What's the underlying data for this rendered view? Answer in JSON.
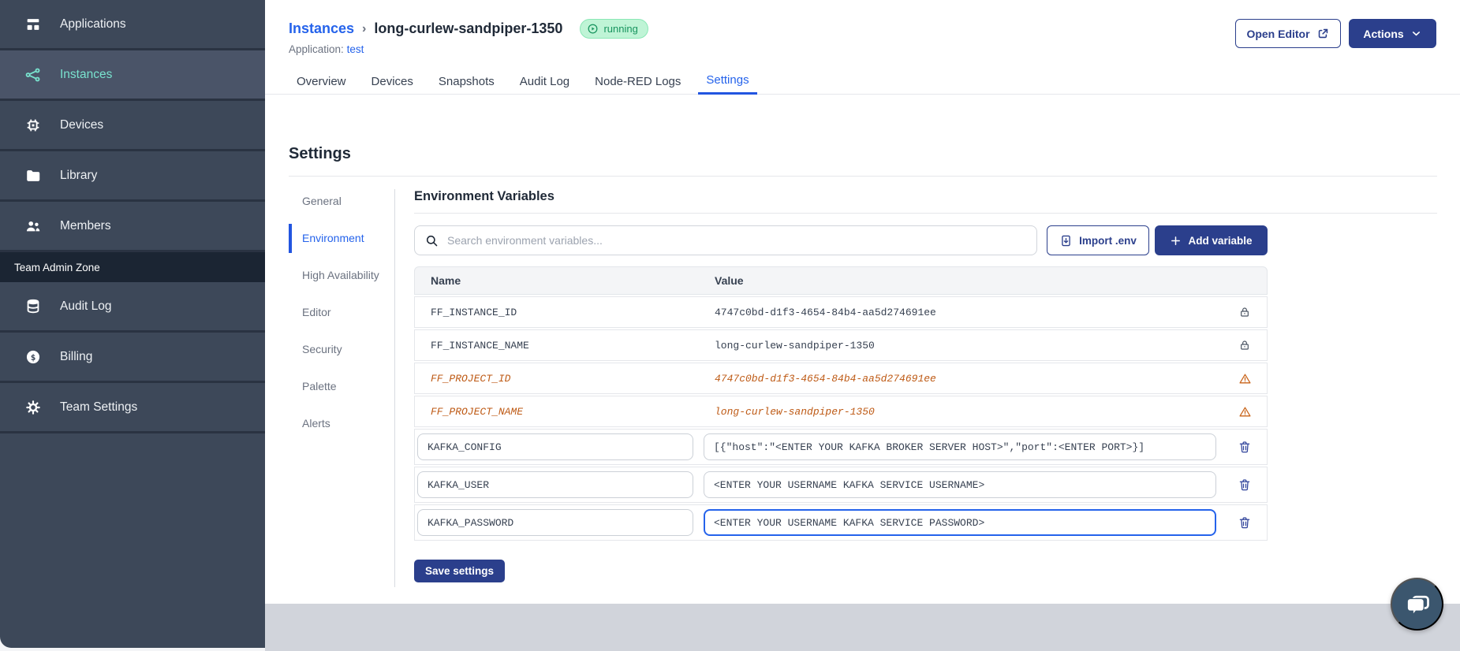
{
  "sidebar": {
    "items": [
      {
        "label": "Applications",
        "icon": "applications-icon",
        "active": false
      },
      {
        "label": "Instances",
        "icon": "instances-icon",
        "active": true
      },
      {
        "label": "Devices",
        "icon": "devices-icon",
        "active": false
      },
      {
        "label": "Library",
        "icon": "library-icon",
        "active": false
      },
      {
        "label": "Members",
        "icon": "members-icon",
        "active": false
      }
    ],
    "section_label": "Team Admin Zone",
    "admin_items": [
      {
        "label": "Audit Log",
        "icon": "audit-log-icon"
      },
      {
        "label": "Billing",
        "icon": "billing-icon"
      },
      {
        "label": "Team Settings",
        "icon": "team-settings-icon"
      }
    ]
  },
  "header": {
    "breadcrumb_root": "Instances",
    "breadcrumb_separator": "›",
    "instance_name": "long-curlew-sandpiper-1350",
    "status_badge": "running",
    "application_label": "Application:",
    "application_name": "test",
    "open_editor_label": "Open Editor",
    "actions_label": "Actions"
  },
  "tabs": [
    "Overview",
    "Devices",
    "Snapshots",
    "Audit Log",
    "Node-RED Logs",
    "Settings"
  ],
  "active_tab": "Settings",
  "settings": {
    "title": "Settings",
    "nav": [
      "General",
      "Environment",
      "High Availability",
      "Editor",
      "Security",
      "Palette",
      "Alerts"
    ],
    "active_nav": "Environment"
  },
  "environment": {
    "title": "Environment Variables",
    "search_placeholder": "Search environment variables...",
    "import_button": "Import .env",
    "add_button": "Add variable",
    "table": {
      "columns": [
        "Name",
        "Value"
      ],
      "rows": [
        {
          "name": "FF_INSTANCE_ID",
          "value": "4747c0bd-d1f3-4654-84b4-aa5d274691ee",
          "state": "locked"
        },
        {
          "name": "FF_INSTANCE_NAME",
          "value": "long-curlew-sandpiper-1350",
          "state": "locked"
        },
        {
          "name": "FF_PROJECT_ID",
          "value": "4747c0bd-d1f3-4654-84b4-aa5d274691ee",
          "state": "deprecated"
        },
        {
          "name": "FF_PROJECT_NAME",
          "value": "long-curlew-sandpiper-1350",
          "state": "deprecated"
        },
        {
          "name": "KAFKA_CONFIG",
          "value": "[{\"host\":\"<ENTER YOUR KAFKA BROKER SERVER HOST>\",\"port\":<ENTER PORT>}]",
          "state": "editable"
        },
        {
          "name": "KAFKA_USER",
          "value": "<ENTER YOUR USERNAME KAFKA SERVICE USERNAME>",
          "state": "editable"
        },
        {
          "name": "KAFKA_PASSWORD",
          "value": "<ENTER YOUR USERNAME KAFKA SERVICE PASSWORD>",
          "state": "editable",
          "focused": true
        }
      ]
    },
    "save_button": "Save settings"
  },
  "colors": {
    "sidebar_bg": "#3D4859",
    "sidebar_active_bg": "#4A5468",
    "teal_accent": "#79E3CF",
    "navy_accent": "#2B3F8C",
    "link_blue": "#2563EB",
    "running_bg": "#BFF4D6",
    "running_text": "#17945E",
    "deprecated_orange": "#BE5A15",
    "footer_gray": "#D1D4DB"
  }
}
